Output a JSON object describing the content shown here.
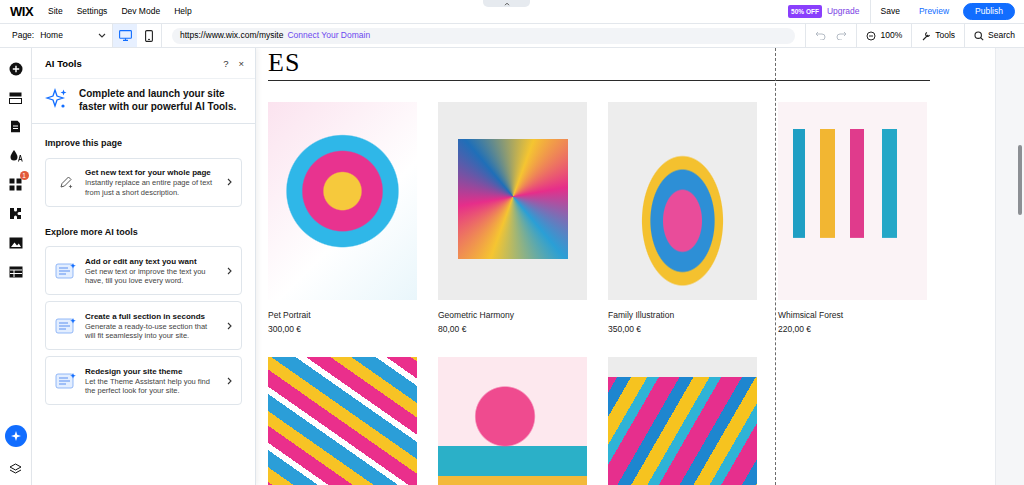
{
  "topbar": {
    "logo": "WIX",
    "menu": [
      "Site",
      "Settings",
      "Dev Mode",
      "Help"
    ],
    "sale_badge": "50% OFF",
    "upgrade": "Upgrade",
    "save": "Save",
    "preview": "Preview",
    "publish": "Publish"
  },
  "toolbar": {
    "page_label": "Page:",
    "page": "Home",
    "devices": [
      {
        "kind": "desktop",
        "selected": true
      },
      {
        "kind": "mobile",
        "selected": false
      }
    ],
    "url": "https://www.wix.com/mysite",
    "connect_domain": "Connect Your Domain",
    "zoom": "100%",
    "tools": "Tools",
    "search": "Search"
  },
  "rail": {
    "apps_badge": "1"
  },
  "ai_panel": {
    "title": "AI Tools",
    "help": "?",
    "close": "×",
    "intro": "Complete and launch your site faster with our powerful AI Tools.",
    "groups": [
      {
        "heading": "Improve this page",
        "cards": [
          {
            "title": "Get new text for your whole page",
            "description": "Instantly replace an entire page of text from just a short description."
          }
        ]
      },
      {
        "heading": "Explore more AI tools",
        "cards": [
          {
            "title": "Add or edit any text you want",
            "description": "Get new text or improve the text you have, till you love every word."
          },
          {
            "title": "Create a full section in seconds",
            "description": "Generate a ready-to-use section that will fit seamlessly into your site."
          },
          {
            "title": "Redesign your site theme",
            "description": "Let the Theme Assistant help you find the perfect look for your site."
          }
        ]
      }
    ]
  },
  "site": {
    "heading": "ES",
    "products": [
      {
        "name": "Pet Portrait",
        "price": "300,00 €"
      },
      {
        "name": "Geometric Harmony",
        "price": "80,00 €"
      },
      {
        "name": "Family Illustration",
        "price": "350,00 €"
      },
      {
        "name": "Whimsical Forest",
        "price": "220,00 €"
      }
    ]
  }
}
